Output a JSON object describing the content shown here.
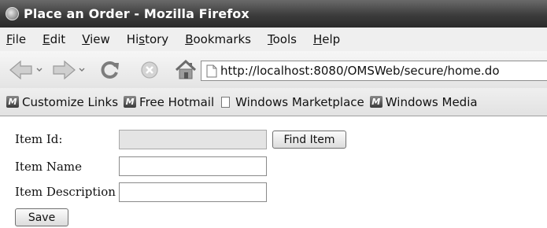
{
  "window": {
    "title": "Place an Order - Mozilla Firefox",
    "icon": "firefox-icon"
  },
  "menu": {
    "items": [
      {
        "label": "File",
        "access_key": "F"
      },
      {
        "label": "Edit",
        "access_key": "E"
      },
      {
        "label": "View",
        "access_key": "V"
      },
      {
        "label": "History",
        "access_key": "s"
      },
      {
        "label": "Bookmarks",
        "access_key": "B"
      },
      {
        "label": "Tools",
        "access_key": "T"
      },
      {
        "label": "Help",
        "access_key": "H"
      }
    ]
  },
  "nav": {
    "url": "http://localhost:8080/OMSWeb/secure/home.do",
    "buttons": [
      "back-icon",
      "forward-icon",
      "reload-icon",
      "stop-icon",
      "home-icon"
    ]
  },
  "bookmarks": [
    {
      "label": "Customize Links",
      "icon": "ms-icon"
    },
    {
      "label": "Free Hotmail",
      "icon": "ms-icon"
    },
    {
      "label": "Windows Marketplace",
      "icon": "page-icon"
    },
    {
      "label": "Windows Media",
      "icon": "ms-icon"
    }
  ],
  "form": {
    "item_id_label": "Item Id:",
    "item_id_value": "",
    "find_item_label": "Find Item",
    "item_name_label": "Item Name",
    "item_name_value": "",
    "item_description_label": "Item Description",
    "item_description_value": "",
    "save_label": "Save"
  }
}
